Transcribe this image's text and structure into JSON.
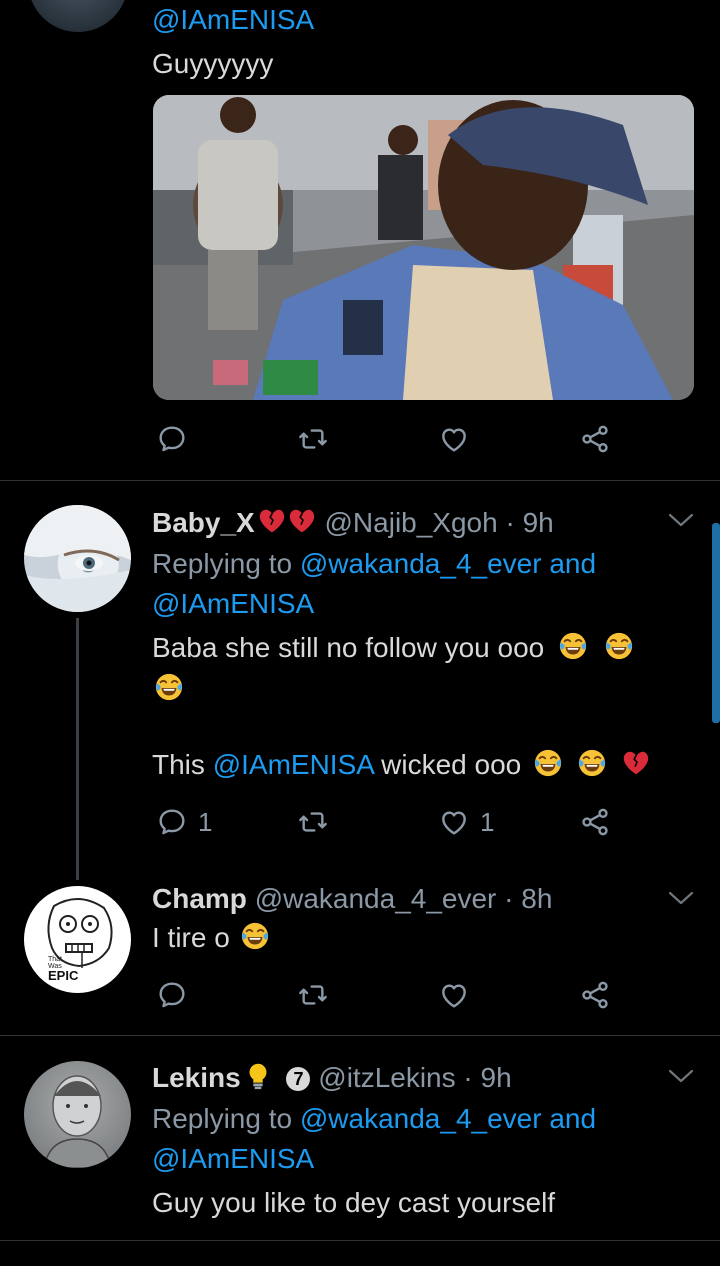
{
  "top_tweet": {
    "handle_line": "@IAmENISA",
    "text": "Guyyyyyy"
  },
  "reply1": {
    "name": "Baby_X",
    "handle": "@Najib_Xgoh",
    "time": "· 9h",
    "replying_prefix": "Replying to",
    "replying_users": "@wakanda_4_ever and",
    "replying_users2": "@IAmENISA",
    "text_line1": "Baba she still no follow you ooo",
    "text_line2_pre": "This",
    "text_line2_mention": "@IAmENISA",
    "text_line2_post": "wicked ooo",
    "reply_count": "1",
    "like_count": "1"
  },
  "reply2": {
    "name": "Champ",
    "handle": "@wakanda_4_ever",
    "time": "· 8h",
    "text": "I tire o",
    "avatar_caption_small": "That Was",
    "avatar_caption_big": "EPIC"
  },
  "reply3": {
    "name": "Lekins",
    "badge": "7",
    "handle": "@itzLekins",
    "time": "· 9h",
    "replying_prefix": "Replying to",
    "replying_users": "@wakanda_4_ever and",
    "replying_users2": "@IAmENISA",
    "text": "Guy you like to dey cast yourself"
  },
  "icons": [
    "reply-icon",
    "retweet-icon",
    "like-icon",
    "share-icon",
    "chevron-down-icon",
    "broken-heart-icon",
    "joy-emoji-icon",
    "bulb-icon"
  ]
}
